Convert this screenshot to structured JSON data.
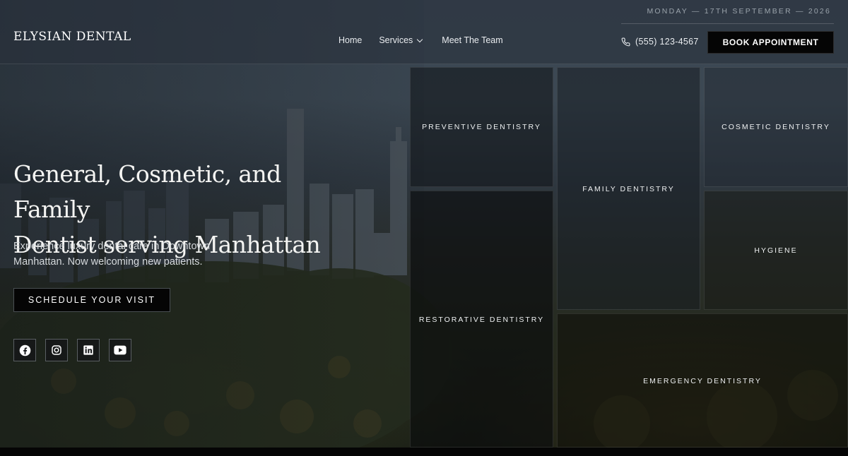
{
  "brand": {
    "name": "ELYSIAN DENTAL"
  },
  "header": {
    "date": "MONDAY — 17TH SEPTEMBER — 2026",
    "nav": {
      "home": "Home",
      "services": "Services",
      "team": "Meet The Team"
    },
    "phone": "(555) 123-4567",
    "book_label": "BOOK APPOINTMENT"
  },
  "hero": {
    "headline_line1": "General, Cosmetic, and Family",
    "headline_line2": "Dentist serving Manhattan",
    "subtext_line1": "Experience luxury dental care in Downtown",
    "subtext_line2": "Manhattan. Now welcoming new patients.",
    "cta_label": "SCHEDULE YOUR VISIT"
  },
  "socials": [
    "facebook-icon",
    "instagram-icon",
    "linkedin-icon",
    "youtube-icon"
  ],
  "services": {
    "preventive": "PREVENTIVE DENTISTRY",
    "family": "FAMILY DENTISTRY",
    "cosmetic": "COSMETIC DENTISTRY",
    "hygiene": "HYGIENE",
    "restorative": "RESTORATIVE DENTISTRY",
    "emergency": "EMERGENCY DENTISTRY"
  },
  "colors": {
    "button_bg": "#050505",
    "text": "#ffffff",
    "muted": "#9aa3ab"
  }
}
